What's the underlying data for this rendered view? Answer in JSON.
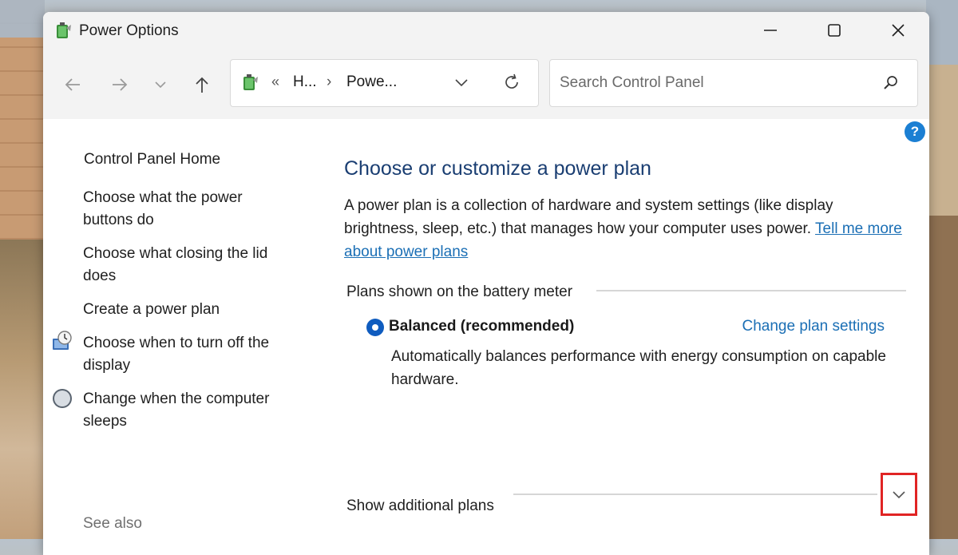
{
  "window": {
    "title": "Power Options"
  },
  "address": {
    "chevrons": "«",
    "seg1": "H...",
    "sep": "›",
    "seg2": "Powe..."
  },
  "search": {
    "placeholder": "Search Control Panel"
  },
  "help": {
    "label": "?"
  },
  "left_pane": {
    "home": "Control Panel Home",
    "links": [
      {
        "label": "Choose what the power buttons do",
        "icon": ""
      },
      {
        "label": "Choose what closing the lid does",
        "icon": ""
      },
      {
        "label": "Create a power plan",
        "icon": ""
      },
      {
        "label": "Choose when to turn off the display",
        "icon": "display-clock-icon"
      },
      {
        "label": "Change when the computer sleeps",
        "icon": "moon-sleep-icon"
      }
    ],
    "see_also": "See also"
  },
  "main": {
    "title": "Choose or customize a power plan",
    "description": "A power plan is a collection of hardware and system settings (like display brightness, sleep, etc.) that manages how your computer uses power.",
    "description_link": "Tell me more about power plans",
    "battery_group": "Plans shown on the battery meter",
    "plan": {
      "name": "Balanced (recommended)",
      "selected": true,
      "settings_link": "Change plan settings",
      "description": "Automatically balances performance with energy consumption on capable hardware."
    },
    "additional_group": "Show additional plans"
  },
  "colors": {
    "accent": "#0f5cbf",
    "link": "#1b6fb5",
    "title": "#1a3e72",
    "highlight": "#e02424"
  }
}
